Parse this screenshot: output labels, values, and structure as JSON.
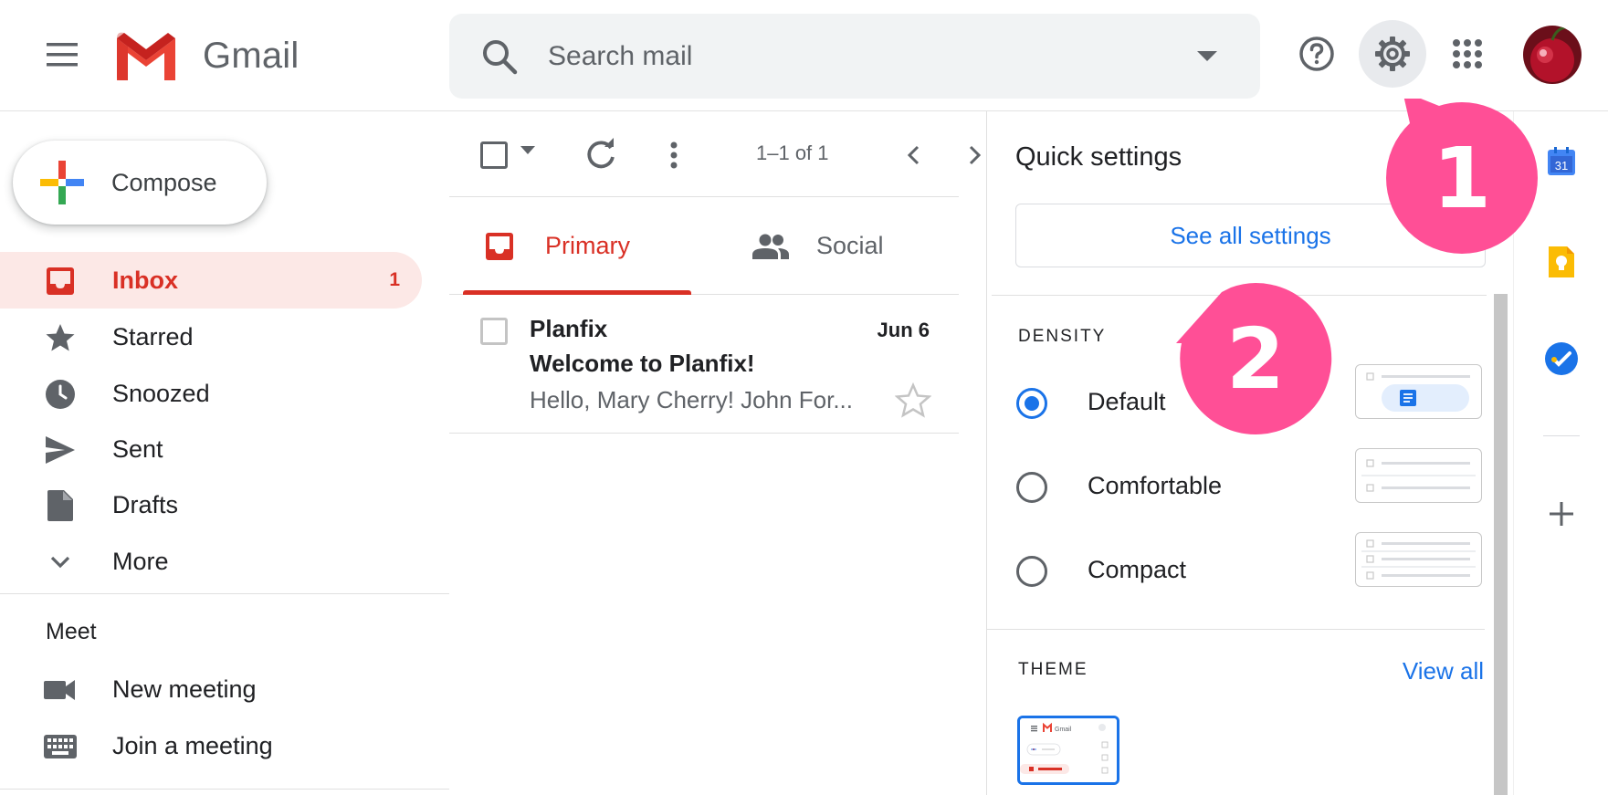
{
  "header": {
    "app_name": "Gmail",
    "search_placeholder": "Search mail"
  },
  "compose": {
    "label": "Compose"
  },
  "sidebar": {
    "items": [
      {
        "label": "Inbox",
        "count": "1"
      },
      {
        "label": "Starred"
      },
      {
        "label": "Snoozed"
      },
      {
        "label": "Sent"
      },
      {
        "label": "Drafts"
      },
      {
        "label": "More"
      }
    ],
    "meet": {
      "title": "Meet",
      "items": [
        {
          "label": "New meeting"
        },
        {
          "label": "Join a meeting"
        }
      ]
    }
  },
  "toolbar": {
    "pagination": "1–1 of 1"
  },
  "tabs": [
    {
      "label": "Primary"
    },
    {
      "label": "Social"
    }
  ],
  "mail": {
    "sender": "Planfix",
    "date": "Jun 6",
    "subject": "Welcome to Planfix!",
    "snippet": "Hello, Mary Cherry! John For..."
  },
  "quick_settings": {
    "title": "Quick settings",
    "see_all": "See all settings",
    "density_title": "DENSITY",
    "density_options": [
      {
        "label": "Default",
        "selected": true
      },
      {
        "label": "Comfortable",
        "selected": false
      },
      {
        "label": "Compact",
        "selected": false
      }
    ],
    "theme_title": "THEME",
    "view_all": "View all",
    "theme_thumb_text": "Gmail"
  },
  "side_panel": {
    "calendar_day": "31"
  },
  "callouts": [
    "1",
    "2"
  ],
  "colors": {
    "accent_red": "#d93025",
    "accent_blue": "#1a73e8",
    "callout_pink": "#ff4f96",
    "inbox_bg": "#fce8e6"
  }
}
